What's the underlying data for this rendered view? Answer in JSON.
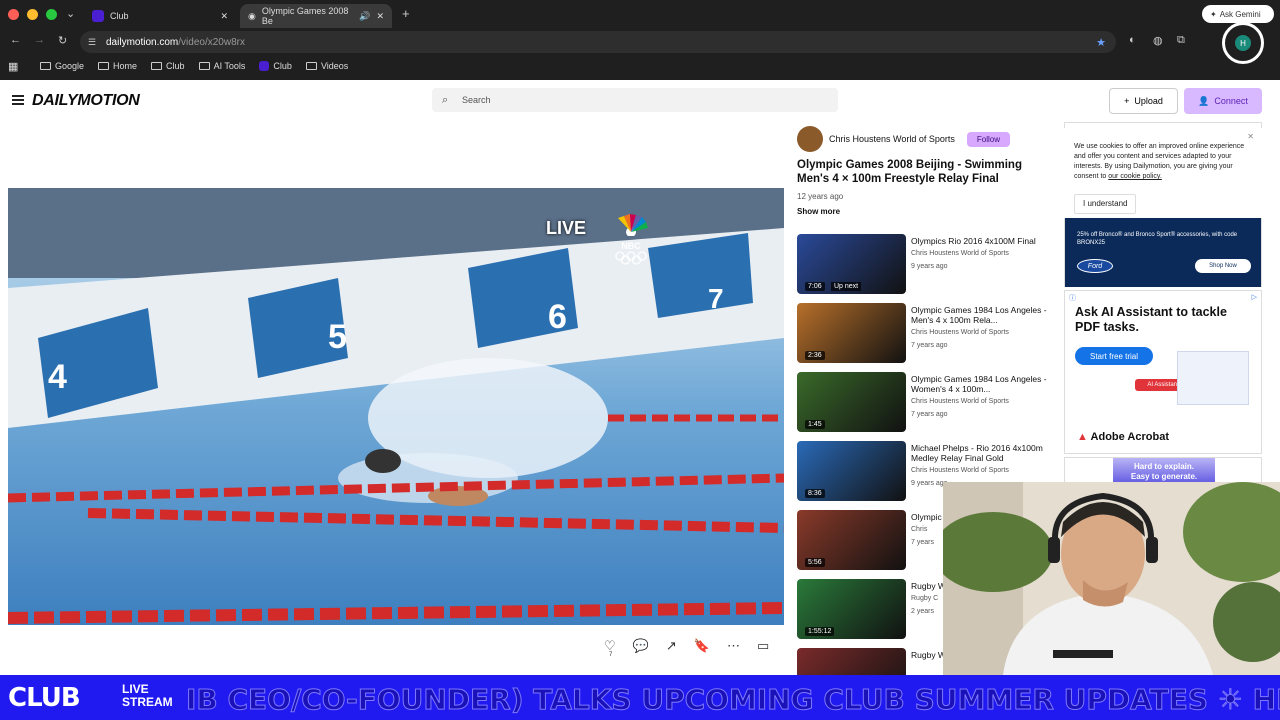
{
  "browser": {
    "tabs": [
      {
        "label": "Club"
      },
      {
        "label": "Olympic Games 2008 Be"
      }
    ],
    "url_domain": "dailymotion.com",
    "url_path": "/video/x20w8rx",
    "bookmarks": [
      "Google",
      "Home",
      "Club",
      "AI Tools",
      "Club",
      "Videos"
    ],
    "ask_label": "Ask Gemini",
    "profile_initial": "H"
  },
  "header": {
    "logo": "DAILYMOTION",
    "search_placeholder": "Search",
    "upload_label": "Upload",
    "connect_label": "Connect"
  },
  "video": {
    "overlay": "LIVE",
    "network": "NBC"
  },
  "actions": {
    "like_count": "7"
  },
  "channel": {
    "name": "Chris Houstens World of Sports",
    "follow_label": "Follow"
  },
  "main_video": {
    "title": "Olympic Games 2008 Beijing - Swimming Men's 4 × 100m Freestyle Relay Final",
    "ago": "12 years ago",
    "show_more": "Show more"
  },
  "recommendations": [
    {
      "title": "Olympics Rio 2016 4x100M Final",
      "channel": "Chris Houstens World of Sports",
      "ago": "9 years ago",
      "duration": "7:06",
      "up_next": "Up next",
      "color": "#2a4a9a"
    },
    {
      "title": "Olympic Games 1984 Los Angeles - Men's 4 x 100m Rela...",
      "channel": "Chris Houstens World of Sports",
      "ago": "7 years ago",
      "duration": "2:36",
      "color": "#b8702a"
    },
    {
      "title": "Olympic Games 1984 Los Angeles - Women's 4 x 100m...",
      "channel": "Chris Houstens World of Sports",
      "ago": "7 years ago",
      "duration": "1:45",
      "color": "#3a6a2a"
    },
    {
      "title": "Michael Phelps - Rio 2016 4x100m Medley Relay Final Gold",
      "channel": "Chris Houstens World of Sports",
      "ago": "9 years ago",
      "duration": "8:36",
      "color": "#2a6ab8"
    },
    {
      "title": "Olympic Angele",
      "channel": "Chris",
      "ago": "7 years",
      "duration": "5:56",
      "color": "#8a3a2a"
    },
    {
      "title": "Rugby W vs New",
      "channel": "Rugby C",
      "ago": "2 years",
      "duration": "1:55:12",
      "color": "#2a7a3a"
    },
    {
      "title": "Rugby W South A",
      "channel": "",
      "ago": "",
      "duration": "",
      "color": "#7a2a2a"
    }
  ],
  "cookie": {
    "text_1": "We use cookies to offer an improved online experience and offer you content and services adapted to your interests. By using Dailymotion, you are giving your consent to",
    "link": "our cookie policy.",
    "button": "I understand"
  },
  "ads": {
    "ford_line": "25% off Bronco® and Bronco Sport® accessories, with code BRONX25",
    "ford_brand": "Ford",
    "ford_cta": "Shop Now",
    "adobe_title": "Ask AI Assistant to tackle PDF tasks.",
    "adobe_cta": "Start free trial",
    "adobe_chip": "AI Assistant",
    "adobe_brand": "Adobe Acrobat",
    "ad3_line1": "Hard to explain.",
    "ad3_line2": "Easy to generate."
  },
  "banner": {
    "logo": "CLUB",
    "live_line1": "LIVE",
    "live_line2": "STREAM",
    "ticker": "IB CEO/CO-FOUNDER) TALKS UPCOMING CLUB SUMMER UPDATES ☀ HENRIK (CL"
  }
}
